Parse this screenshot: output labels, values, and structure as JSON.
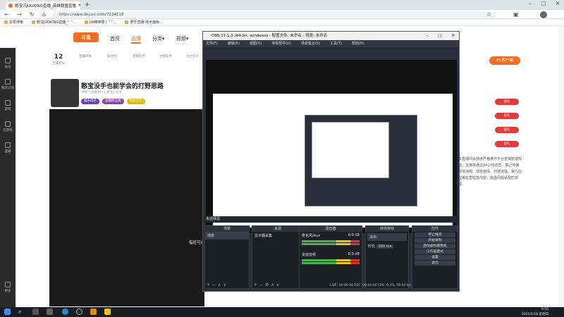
{
  "browser": {
    "tab_title": "憨宝沉JUGKING直播_英雄联盟直播",
    "url": "https://www.douyu.com/7234118",
    "bookmarks": [
      "恩爱搜索",
      "憨宝JUGKING直播_“ ‘’...",
      "JW精神楼 | “ ‘’...",
      "虎牙直播-技术面板..."
    ]
  },
  "douyu": {
    "logo": "斗鱼",
    "nav": [
      "首页",
      "直播",
      "分类▾",
      "视频▾"
    ],
    "stats": [
      {
        "num": "12",
        "label": "主播积分"
      },
      {
        "num": "",
        "label": "直播开关"
      },
      {
        "num": "",
        "label": "粉丝团"
      },
      {
        "num": "",
        "label": "直播任务"
      },
      {
        "num": "",
        "label": "主播任务"
      },
      {
        "num": "",
        "label": "大力全开"
      }
    ],
    "stream_title": "憨宝没手也能学会的打野思路",
    "meta": "举报  | 主播评价  | 关注 | 分享",
    "badges": [
      "娱乐排名",
      "直播粉丝牌",
      "粉丝宝宝"
    ],
    "left_sidebar": [
      "关注",
      "我的订阅",
      "游戏",
      "云游戏",
      "直播",
      "更多"
    ],
    "pc_client": "PC客户端",
    "gift_label": "送礼",
    "notice": "本直播间会持续严格遵守平台直播管理规范，主播将通过24小时巡查，禁止传播违法违规、低俗色情、封建迷信、暴力血腥等有害信息内容，如遇问题请及时举报。",
    "player_text": "指还可以"
  },
  "obs": {
    "title": "OBS 27.1.3 (64-bit, windows) - 配置文件: 未命名 - 场景: 未命名",
    "menu": [
      "文件(F)",
      "编辑(E)",
      "视图(V)",
      "停靠部件(D)",
      "场景集合(S)",
      "工具(T)",
      "帮助(H)"
    ],
    "scene_bar": "未选择源",
    "docks": {
      "scenes": "场景",
      "sources": "来源",
      "mixer": "混音器",
      "transitions": "转场特效",
      "controls": "控件"
    },
    "scene_item": "场景",
    "source_item": "显示器采集",
    "mixer_items": [
      {
        "name": "麦克风/Aux",
        "db": "0.0 dB"
      },
      {
        "name": "桌面音频",
        "db": "0.0 dB"
      }
    ],
    "transition": {
      "type": "淡出",
      "duration_label": "时长",
      "duration": "300 ms"
    },
    "controls": [
      "停止推流",
      "开始录制",
      "启动虚拟摄像机",
      "工作室模式",
      "设置",
      "退出"
    ],
    "status": "LIVE: 00:00:00   REC: 00:00:00   CPU: 0.3%, 59.94 fps"
  },
  "taskbar": {
    "time": "9:56",
    "date": "2022/2/10 星期四"
  }
}
